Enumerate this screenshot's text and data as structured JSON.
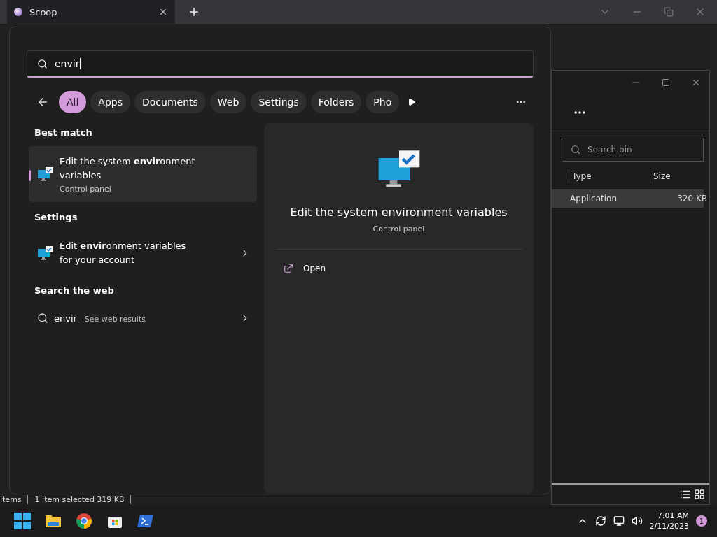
{
  "browser": {
    "tab": {
      "title": "Scoop"
    }
  },
  "search_panel": {
    "query": "envir",
    "filters": [
      {
        "label": "All",
        "selected": true
      },
      {
        "label": "Apps",
        "selected": false
      },
      {
        "label": "Documents",
        "selected": false
      },
      {
        "label": "Web",
        "selected": false
      },
      {
        "label": "Settings",
        "selected": false
      },
      {
        "label": "Folders",
        "selected": false
      },
      {
        "label": "Pho",
        "selected": false
      }
    ],
    "sections": [
      {
        "heading": "Best match",
        "results": [
          {
            "kind": "app",
            "title": "Edit the system **envir**onment variables",
            "subtitle": "Control panel",
            "selected": true
          }
        ]
      },
      {
        "heading": "Settings",
        "results": [
          {
            "kind": "setting",
            "title": "Edit **envir**onment variables for your account",
            "selected": false
          }
        ]
      },
      {
        "heading": "Search the web",
        "results": [
          {
            "kind": "web",
            "title": "envir",
            "subtitle": " - See web results",
            "selected": false
          }
        ]
      }
    ],
    "preview": {
      "title": "Edit the system environment variables",
      "subtitle": "Control panel",
      "actions": [
        "Open"
      ]
    }
  },
  "explorer": {
    "search_placeholder": "Search bin",
    "columns": [
      "Type",
      "Size"
    ],
    "rows": [
      {
        "type": "Application",
        "size": "320 KB",
        "selected": true
      }
    ],
    "status": [
      "items",
      "1 item selected  319 KB"
    ]
  },
  "taskbar": {
    "time": "7:01 AM",
    "date": "2/11/2023",
    "notification_count": "1"
  }
}
